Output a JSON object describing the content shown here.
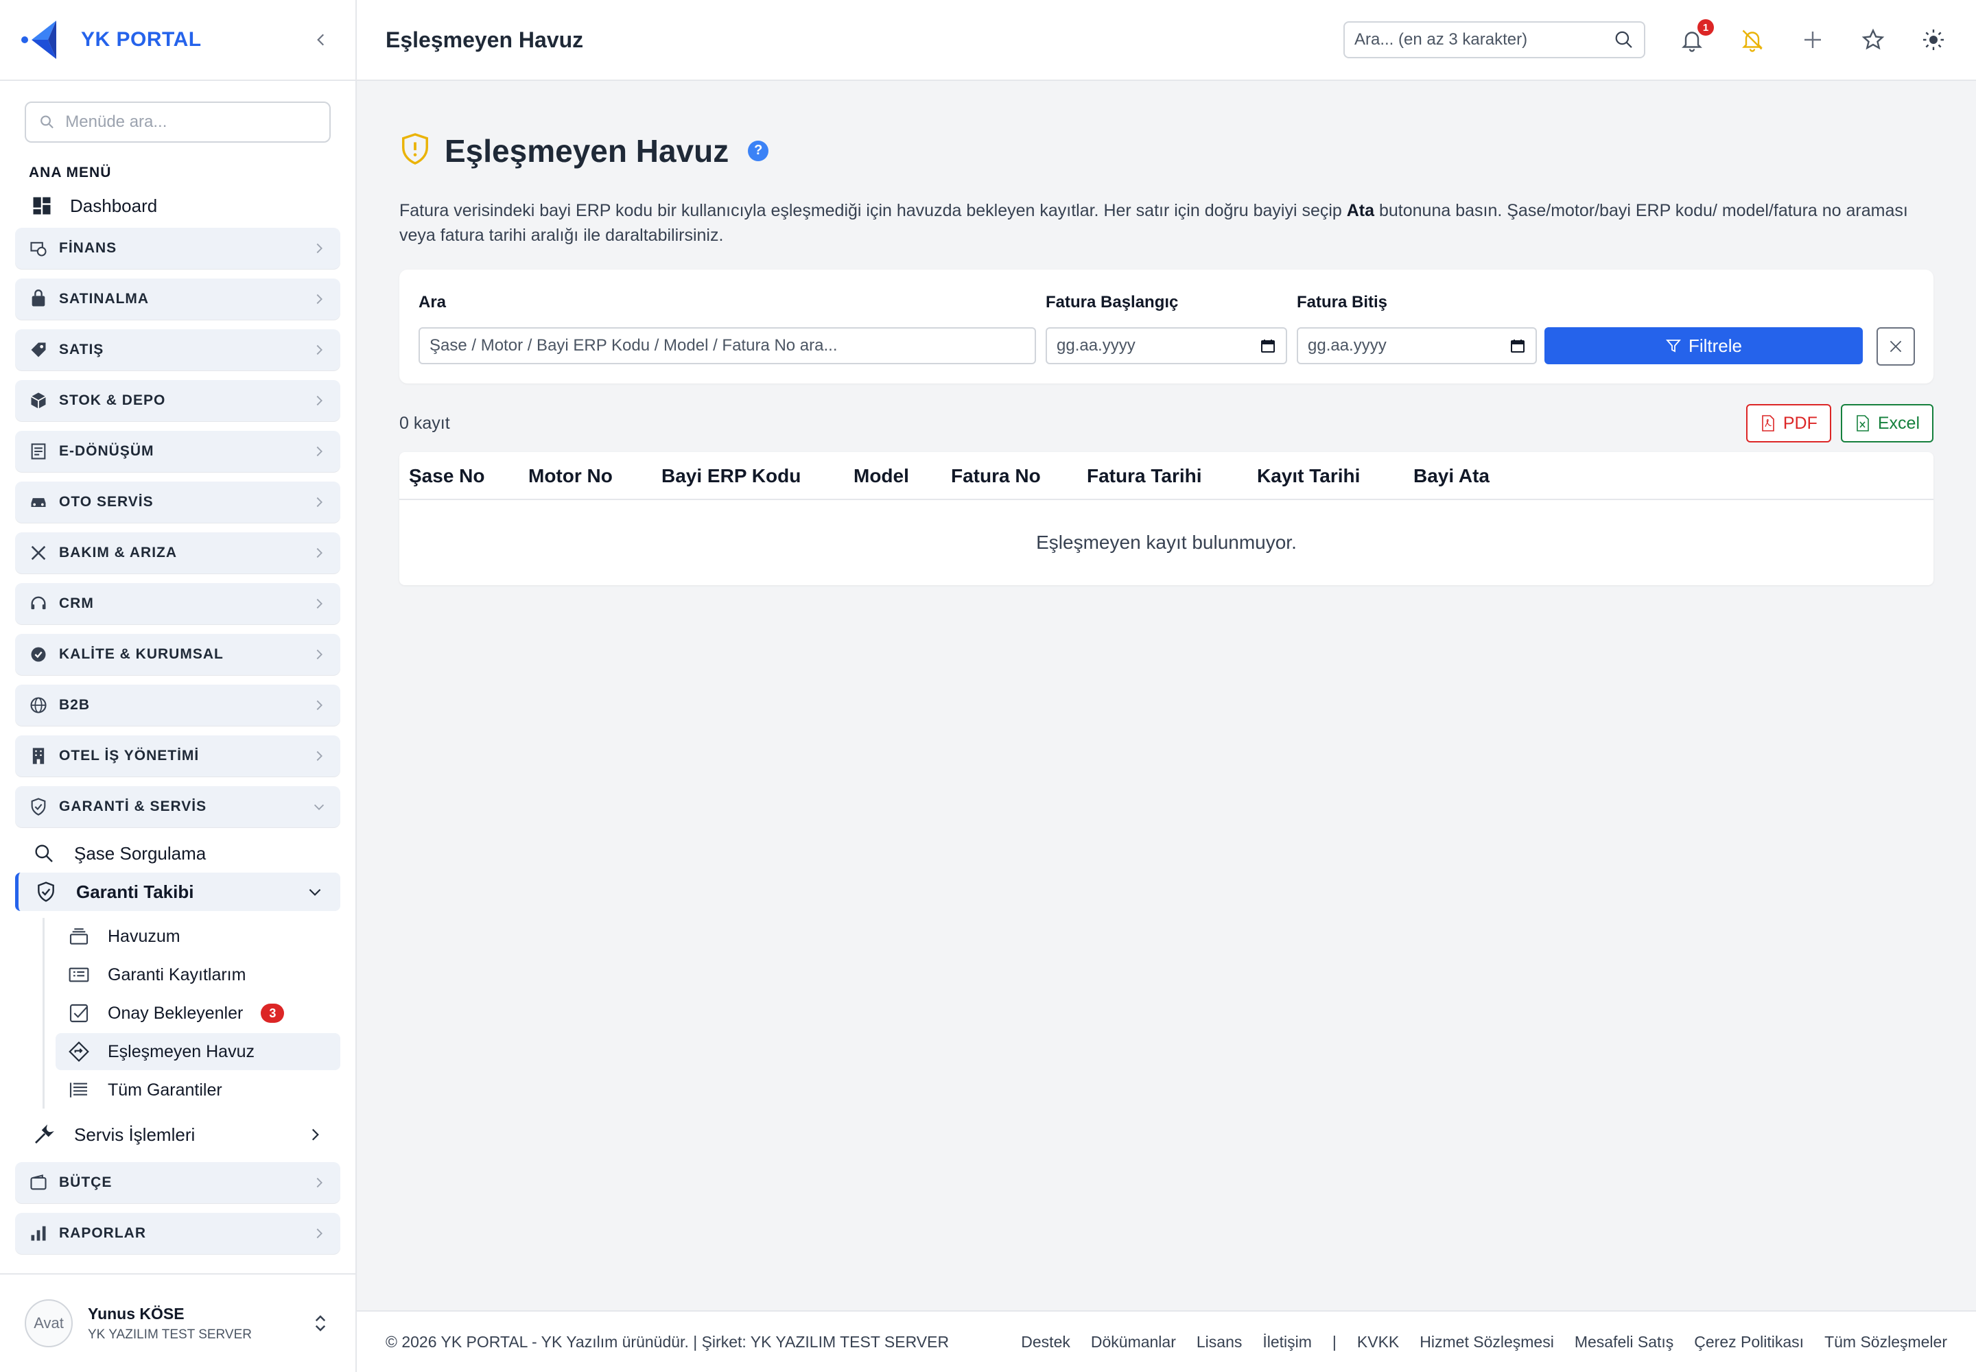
{
  "app": {
    "name": "YK PORTAL"
  },
  "sidebar": {
    "search_placeholder": "Menüde ara...",
    "section_title": "ANA MENÜ",
    "dashboard_label": "Dashboard",
    "groups": [
      {
        "label": "FİNANS",
        "icon": "finance-icon"
      },
      {
        "label": "SATINALMA",
        "icon": "bag-icon"
      },
      {
        "label": "SATIŞ",
        "icon": "tag-icon"
      },
      {
        "label": "STOK & DEPO",
        "icon": "box-icon"
      },
      {
        "label": "E-DÖNÜŞÜM",
        "icon": "document-icon"
      },
      {
        "label": "OTO SERVİS",
        "icon": "car-icon"
      },
      {
        "label": "BAKIM & ARIZA",
        "icon": "tools-icon"
      },
      {
        "label": "CRM",
        "icon": "headset-icon"
      },
      {
        "label": "KALİTE & KURUMSAL",
        "icon": "badge-check-icon"
      },
      {
        "label": "B2B",
        "icon": "globe-icon"
      },
      {
        "label": "OTEL İŞ YÖNETİMİ",
        "icon": "building-icon"
      },
      {
        "label": "GARANTİ & SERVİS",
        "icon": "shield-icon"
      }
    ],
    "warranty_items": {
      "chassis_query": "Şase Sorgulama",
      "warranty_tracking": "Garanti Takibi",
      "sub": [
        {
          "label": "Havuzum"
        },
        {
          "label": "Garanti Kayıtlarım"
        },
        {
          "label": "Onay Bekleyenler",
          "badge": "3"
        },
        {
          "label": "Eşleşmeyen Havuz"
        },
        {
          "label": "Tüm Garantiler"
        }
      ],
      "service_ops": "Servis İşlemleri"
    },
    "bottom_groups": [
      {
        "label": "BÜTÇE",
        "icon": "wallet-icon"
      },
      {
        "label": "RAPORLAR",
        "icon": "bar-chart-icon"
      }
    ],
    "user": {
      "name": "Yunus KÖSE",
      "org": "YK YAZILIM TEST SERVER",
      "avatar_alt": "Avat"
    }
  },
  "topbar": {
    "title": "Eşleşmeyen Havuz",
    "search_placeholder": "Ara... (en az 3 karakter)",
    "notification_count": "1"
  },
  "main": {
    "title": "Eşleşmeyen Havuz",
    "help": "?",
    "desc_part1": "Fatura verisindeki bayi ERP kodu bir kullanıcıyla eşleşmediği için havuzda bekleyen kayıtlar. Her satır için doğru bayiyi seçip ",
    "desc_bold": "Ata",
    "desc_part2": " butonuna basın. Şase/motor/bayi ERP kodu/ model/fatura no araması veya fatura tarihi aralığı ile daraltabilirsiniz.",
    "filter": {
      "search_label": "Ara",
      "search_placeholder": "Şase / Motor / Bayi ERP Kodu / Model / Fatura No ara...",
      "start_label": "Fatura Başlangıç",
      "start_placeholder": "gg.aa.yyyy",
      "end_label": "Fatura Bitiş",
      "end_placeholder": "gg.aa.yyyy",
      "filter_button": "Filtrele"
    },
    "record_count": "0 kayıt",
    "pdf_button": "PDF",
    "excel_button": "Excel",
    "table": {
      "columns": [
        "Şase No",
        "Motor No",
        "Bayi ERP Kodu",
        "Model",
        "Fatura No",
        "Fatura Tarihi",
        "Kayıt Tarihi",
        "Bayi Ata"
      ],
      "empty_message": "Eşleşmeyen kayıt bulunmuyor."
    }
  },
  "footer": {
    "copyright": "© 2026 YK PORTAL - YK Yazılım ürünüdür. | Şirket: YK YAZILIM TEST SERVER",
    "links": [
      "Destek",
      "Dökümanlar",
      "Lisans",
      "İletişim"
    ],
    "separator": "|",
    "legal_links": [
      "KVKK",
      "Hizmet Sözleşmesi",
      "Mesafeli Satış",
      "Çerez Politikası",
      "Tüm Sözleşmeler"
    ]
  },
  "colors": {
    "primary": "#2563eb",
    "danger": "#dc2626",
    "success": "#15803d",
    "warning": "#eab308"
  }
}
